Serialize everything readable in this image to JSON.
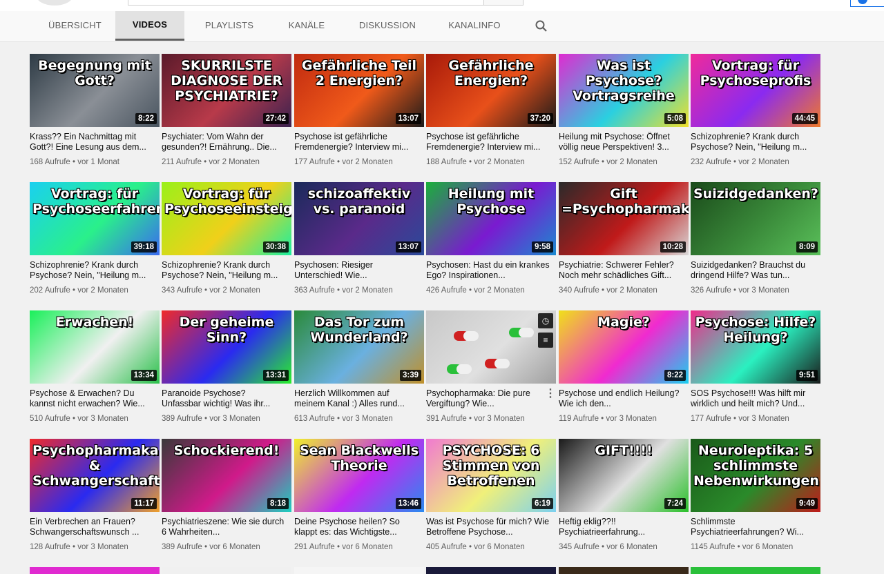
{
  "tabs": [
    "ÜBERSICHT",
    "VIDEOS",
    "PLAYLISTS",
    "KANÄLE",
    "DISKUSSION",
    "KANALINFO"
  ],
  "active_tab": "VIDEOS",
  "icons": {
    "search": "search-icon",
    "watch_later": "clock-icon",
    "add_to_queue": "queue-icon",
    "more": "more-vert-icon"
  },
  "videos": [
    {
      "thumb_text": "Begegnung mit Gott?",
      "duration": "8:22",
      "title": "Krass?? Ein Nachmittag mit Gott?! Eine Lesung aus dem...",
      "views": "168 Aufrufe",
      "age": "vor 1 Monat",
      "colors": [
        "#2e3b45",
        "#8a8f96",
        "#4a5560"
      ]
    },
    {
      "thumb_text": "SKURRILSTE DIAGNOSE DER PSYCHIATRIE?",
      "duration": "27:42",
      "title": "Psychiater: Vom Wahn der gesunden?! Ernährung.. Die...",
      "views": "211 Aufrufe",
      "age": "vor 2 Monaten",
      "colors": [
        "#5a1a2a",
        "#b83a4a",
        "#3a2250"
      ]
    },
    {
      "thumb_text": "Gefährliche Teil 2 Energien?",
      "duration": "13:07",
      "title": "Psychose ist gefährliche Fremdenergie? Interview mi...",
      "views": "177 Aufrufe",
      "age": "vor 2 Monaten",
      "colors": [
        "#c02a10",
        "#f05a1a",
        "#1a1a1a"
      ]
    },
    {
      "thumb_text": "Gefährliche Energien?",
      "duration": "37:20",
      "title": "Psychose ist gefährliche Fremdenergie? Interview mi...",
      "views": "188 Aufrufe",
      "age": "vor 2 Monaten",
      "colors": [
        "#a81a0a",
        "#e8501a",
        "#1a1a1a"
      ]
    },
    {
      "thumb_text": "Was ist Psychose? Vortragsreihe",
      "duration": "5:08",
      "title": "Heilung mit Psychose: Öffnet völlig neue Perspektiven! 3...",
      "views": "152 Aufrufe",
      "age": "vor 2 Monaten",
      "colors": [
        "#e02ad0",
        "#2ad0e0",
        "#f0e02a"
      ]
    },
    {
      "thumb_text": "Vortrag: für Psychoseprofis",
      "duration": "44:45",
      "title": "Schizophrenie? Krank durch Psychose? Nein, \"Heilung m...",
      "views": "232 Aufrufe",
      "age": "vor 2 Monaten",
      "colors": [
        "#f02a9a",
        "#8a2af0",
        "#f07a2a"
      ]
    },
    {
      "thumb_text": "Vortrag: für Psychoseerfahrene",
      "duration": "39:18",
      "title": "Schizophrenie? Krank durch Psychose? Nein, \"Heilung m...",
      "views": "202 Aufrufe",
      "age": "vor 2 Monaten",
      "colors": [
        "#1ad0f0",
        "#2af08a",
        "#3a6af0"
      ]
    },
    {
      "thumb_text": "Vortrag: für Psychoseeinsteiger",
      "duration": "30:38",
      "title": "Schizophrenie? Krank durch Psychose? Nein, \"Heilung m...",
      "views": "343 Aufrufe",
      "age": "vor 2 Monaten",
      "colors": [
        "#9af01a",
        "#f0d01a",
        "#1af0a0"
      ]
    },
    {
      "thumb_text": "schizoaffektiv vs. paranoid",
      "duration": "13:07",
      "title": "Psychosen: Riesiger Unterschied! Wie...",
      "views": "363 Aufrufe",
      "age": "vor 2 Monaten",
      "colors": [
        "#1a2a5a",
        "#5a2a8a",
        "#2a4a9a"
      ]
    },
    {
      "thumb_text": "Heilung mit Psychose",
      "duration": "9:58",
      "title": "Psychosen: Hast du ein krankes Ego? Inspirationen...",
      "views": "426 Aufrufe",
      "age": "vor 2 Monaten",
      "colors": [
        "#1ab03a",
        "#7a1ad0",
        "#1a8ad0"
      ]
    },
    {
      "thumb_text": "Gift =Psychopharmaka",
      "duration": "10:28",
      "title": "Psychiatrie: Schwerer Fehler? Noch mehr schädliches Gift...",
      "views": "340 Aufrufe",
      "age": "vor 2 Monaten",
      "colors": [
        "#2a2a2a",
        "#c01a1a",
        "#d8d8d8"
      ]
    },
    {
      "thumb_text": "Suizidgedanken?",
      "duration": "8:09",
      "title": "Suizidgedanken? Brauchst du dringend Hilfe? Was tun...",
      "views": "326 Aufrufe",
      "age": "vor 3 Monaten",
      "colors": [
        "#1a4a1a",
        "#3a8a3a",
        "#5ac05a"
      ]
    },
    {
      "thumb_text": "Erwachen!",
      "duration": "13:34",
      "title": "Psychose & Erwachen? Du kannst nicht erwachen? Wie...",
      "views": "510 Aufrufe",
      "age": "vor 3 Monaten",
      "colors": [
        "#1af05a",
        "#f0f0f0",
        "#2ac04a"
      ]
    },
    {
      "thumb_text": "Der geheime Sinn?",
      "duration": "13:31",
      "title": "Paranoide Psychose? Unfassbar wichtig! Was ihr...",
      "views": "389 Aufrufe",
      "age": "vor 3 Monaten",
      "colors": [
        "#f02a2a",
        "#2a2af0",
        "#2af02a"
      ]
    },
    {
      "thumb_text": "Das Tor zum Wunderland?",
      "duration": "3:39",
      "title": "Herzlich Willkommen auf meinem Kanal :) Alles rund...",
      "views": "613 Aufrufe",
      "age": "vor 3 Monaten",
      "colors": [
        "#2a8a3a",
        "#6ab0e0",
        "#c0902a"
      ]
    },
    {
      "thumb_text": "",
      "duration": "",
      "title": "Psychopharmaka: Die pure Vergiftung? Wie...",
      "views": "391 Aufrufe",
      "age": "vor 3 Monaten",
      "colors": [
        "#c8c8c8",
        "#e0e0e0",
        "#a0a0a0"
      ]
    },
    {
      "thumb_text": "Magie?",
      "duration": "8:22",
      "title": "Psychose und endlich Heilung? Wie ich den...",
      "views": "119 Aufrufe",
      "age": "vor 3 Monaten",
      "colors": [
        "#f0e01a",
        "#f02ad0",
        "#1ad0f0"
      ]
    },
    {
      "thumb_text": "Psychose: Hilfe? Heilung?",
      "duration": "9:51",
      "title": "SOS Psychose!!! Was hilft mir wirklich und heilt mich? Und...",
      "views": "177 Aufrufe",
      "age": "vor 3 Monaten",
      "colors": [
        "#f02a8a",
        "#2af0c0",
        "#1a1a1a"
      ]
    },
    {
      "thumb_text": "Psychopharmaka & Schwangerschaft?",
      "duration": "11:17",
      "title": "Ein Verbrechen an Frauen? Schwangerschaftswunsch ...",
      "views": "128 Aufrufe",
      "age": "vor 3 Monaten",
      "colors": [
        "#f02a2a",
        "#2a2af0",
        "#f0a02a"
      ]
    },
    {
      "thumb_text": "Schockierend!",
      "duration": "8:18",
      "title": "Psychiatrieszene: Wie sie durch 6 Wahrheiten...",
      "views": "389 Aufrufe",
      "age": "vor 6 Monaten",
      "colors": [
        "#3a3a3a",
        "#d01a8a",
        "#1ad0c0"
      ]
    },
    {
      "thumb_text": "Sean Blackwells Theorie",
      "duration": "13:46",
      "title": "Deine Psychose heilen? So klappt es: das Wichtigste...",
      "views": "291 Aufrufe",
      "age": "vor 6 Monaten",
      "colors": [
        "#f0f02a",
        "#c02af0",
        "#2a8af0"
      ]
    },
    {
      "thumb_text": "PSYCHOSE: 6 Stimmen von Betroffenen",
      "duration": "6:19",
      "title": "Was ist Psychose für mich? Wie Betroffene Psychose...",
      "views": "405 Aufrufe",
      "age": "vor 6 Monaten",
      "colors": [
        "#f07ad0",
        "#f0f07a",
        "#7ad0f0"
      ]
    },
    {
      "thumb_text": "GIFT!!!!",
      "duration": "7:24",
      "title": "Heftig eklig??!! Psychiatrieerfahrung...",
      "views": "345 Aufrufe",
      "age": "vor 6 Monaten",
      "colors": [
        "#1a1a1a",
        "#e0e0e0",
        "#2ac02a"
      ]
    },
    {
      "thumb_text": "Neuroleptika: 5 schlimmste Nebenwirkungen",
      "duration": "9:49",
      "title": "Schlimmste Psychiatrieerfahrungen? Wi...",
      "views": "1145 Aufrufe",
      "age": "vor 6 Monaten",
      "colors": [
        "#1a5a1a",
        "#2a8a2a",
        "#c01a1a"
      ]
    }
  ],
  "partial_row_colors": [
    "#e02ad0",
    "#f0f0f0",
    "#f5f5f5",
    "#1a1a3a",
    "#3a2a1a",
    "#2ac03a"
  ]
}
